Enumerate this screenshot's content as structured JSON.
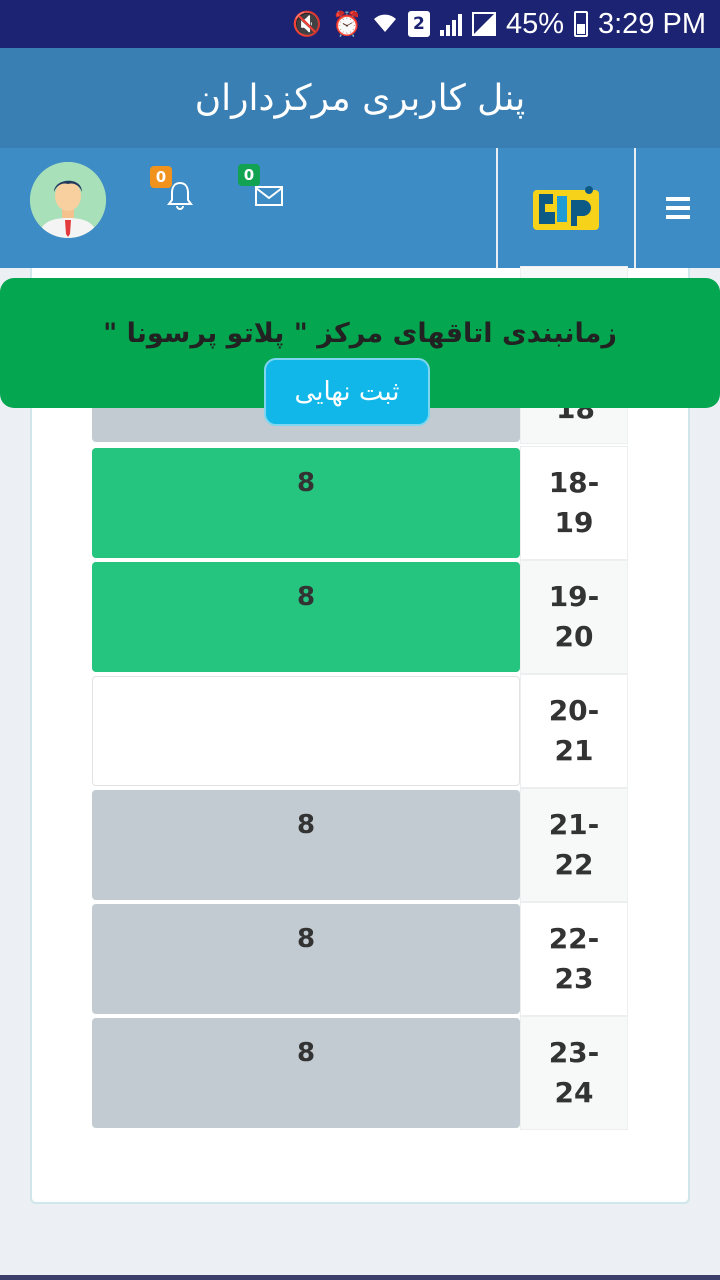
{
  "status_bar": {
    "battery": "45%",
    "time": "3:29 PM",
    "sim_slot": "2"
  },
  "header": {
    "title": "پنل کاربری مرکزداران"
  },
  "navbar": {
    "notifications_count": "0",
    "messages_count": "0",
    "menu_icon": "hamburger-icon",
    "bell_icon": "bell-icon",
    "mail_icon": "envelope-icon",
    "logo_icon": "platto-logo",
    "avatar_icon": "user-avatar"
  },
  "banner": {
    "text": "زمانبندی اتاقهای مرکز \" پلاتو پرسونا \"",
    "submit_label": "ثبت نهایی",
    "partial_time": "18"
  },
  "schedule": {
    "rows": [
      {
        "time_start": "18-",
        "time_end": "19",
        "value": "8",
        "state": "green"
      },
      {
        "time_start": "19-",
        "time_end": "20",
        "value": "8",
        "state": "green"
      },
      {
        "time_start": "20-",
        "time_end": "21",
        "value": "",
        "state": "white"
      },
      {
        "time_start": "21-",
        "time_end": "22",
        "value": "8",
        "state": "grey"
      },
      {
        "time_start": "22-",
        "time_end": "23",
        "value": "8",
        "state": "grey"
      },
      {
        "time_start": "23-",
        "time_end": "24",
        "value": "8",
        "state": "grey"
      }
    ]
  },
  "colors": {
    "status_bar": "#1c2372",
    "title_bar": "#3a7fb3",
    "navbar": "#3e8cc5",
    "banner": "#04a64f",
    "button": "#11b7e8",
    "slot_green": "#25c47f",
    "slot_grey": "#c1cbd1"
  }
}
